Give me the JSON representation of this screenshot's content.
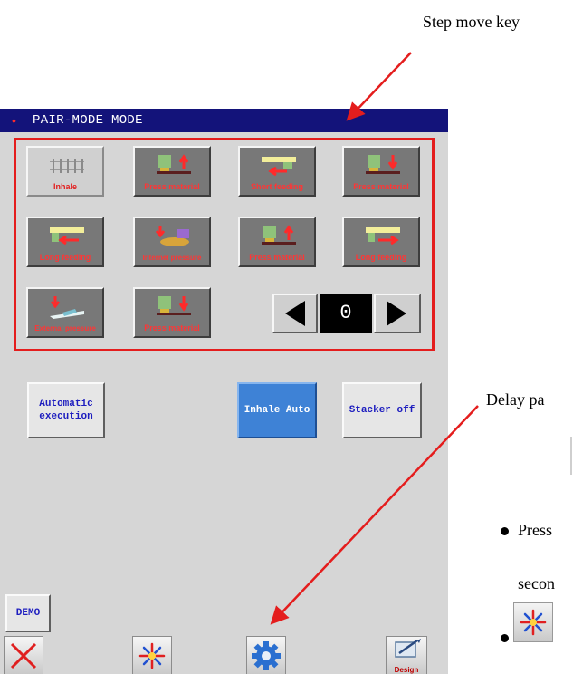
{
  "annotations": {
    "step_move_key": "Step move key",
    "delay_pa": "Delay pa",
    "press": "Press",
    "secon": "secon"
  },
  "screen": {
    "title": "PAIR-MODE MODE",
    "steps": [
      {
        "label": "Inhale",
        "icon": "inhale-icon"
      },
      {
        "label": "Press material",
        "icon": "press-material-up-icon"
      },
      {
        "label": "Short feeding",
        "icon": "short-feeding-icon"
      },
      {
        "label": "Press material",
        "icon": "press-material-down-icon"
      },
      {
        "label": "Long feeding",
        "icon": "long-feeding-left-icon"
      },
      {
        "label": "Internel pressure",
        "icon": "internal-pressure-icon"
      },
      {
        "label": "Press material",
        "icon": "press-material-up-icon"
      },
      {
        "label": "Long feeding",
        "icon": "long-feeding-right-icon"
      },
      {
        "label": "External pressure",
        "icon": "external-pressure-icon"
      },
      {
        "label": "Press material",
        "icon": "press-material-down-icon"
      }
    ],
    "step_counter": "0",
    "buttons": {
      "automatic_execution_line1": "Automatic",
      "automatic_execution_line2": "execution",
      "inhale_auto": "Inhale Auto",
      "stacker_off": "Stacker off",
      "demo": "DEMO"
    },
    "toolbar": {
      "design_label": "Design"
    }
  },
  "colors": {
    "titlebar": "#13137a",
    "highlight_frame": "#e41d1d",
    "arrow_annotation": "#e41d1d",
    "blue_button": "#3e82d6"
  }
}
